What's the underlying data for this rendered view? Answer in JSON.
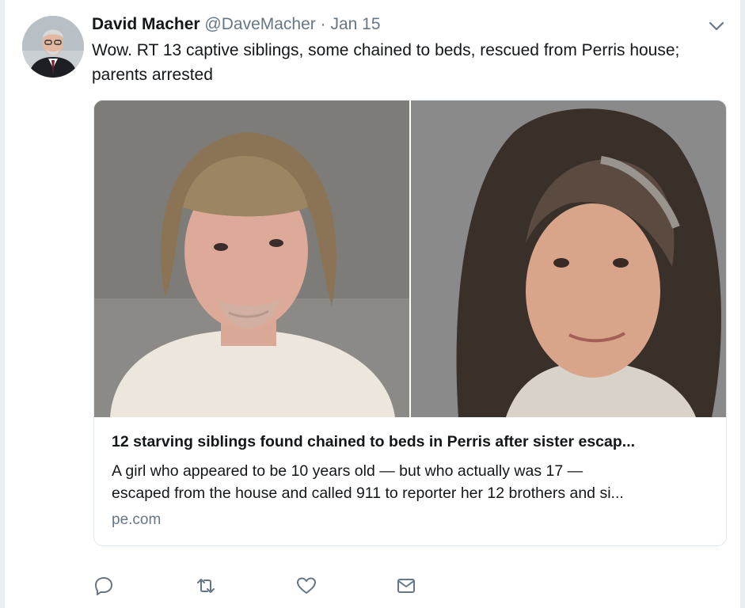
{
  "tweet": {
    "author_name": "David Macher",
    "handle": "@DaveMacher",
    "separator": "·",
    "date": "Jan 15",
    "text": "Wow. RT 13 captive siblings, some chained to beds, rescued from Perris house; parents arrested"
  },
  "card": {
    "title": "12 starving siblings found chained to beds in Perris after sister escap...",
    "description_line1": "A girl who appeared to be 10 years old — but who actually was 17 —",
    "description_line2": "escaped from the house and called 911 to reporter her 12 brothers and si...",
    "domain": "pe.com"
  },
  "icons": {
    "menu": "chevron-down-icon",
    "reply": "reply-icon",
    "retweet": "retweet-icon",
    "like": "heart-icon",
    "dm": "envelope-icon"
  },
  "colors": {
    "text": "#14171a",
    "secondary": "#657786",
    "icon": "#657786",
    "border": "#e1e8ed",
    "background": "#e9eef2"
  }
}
